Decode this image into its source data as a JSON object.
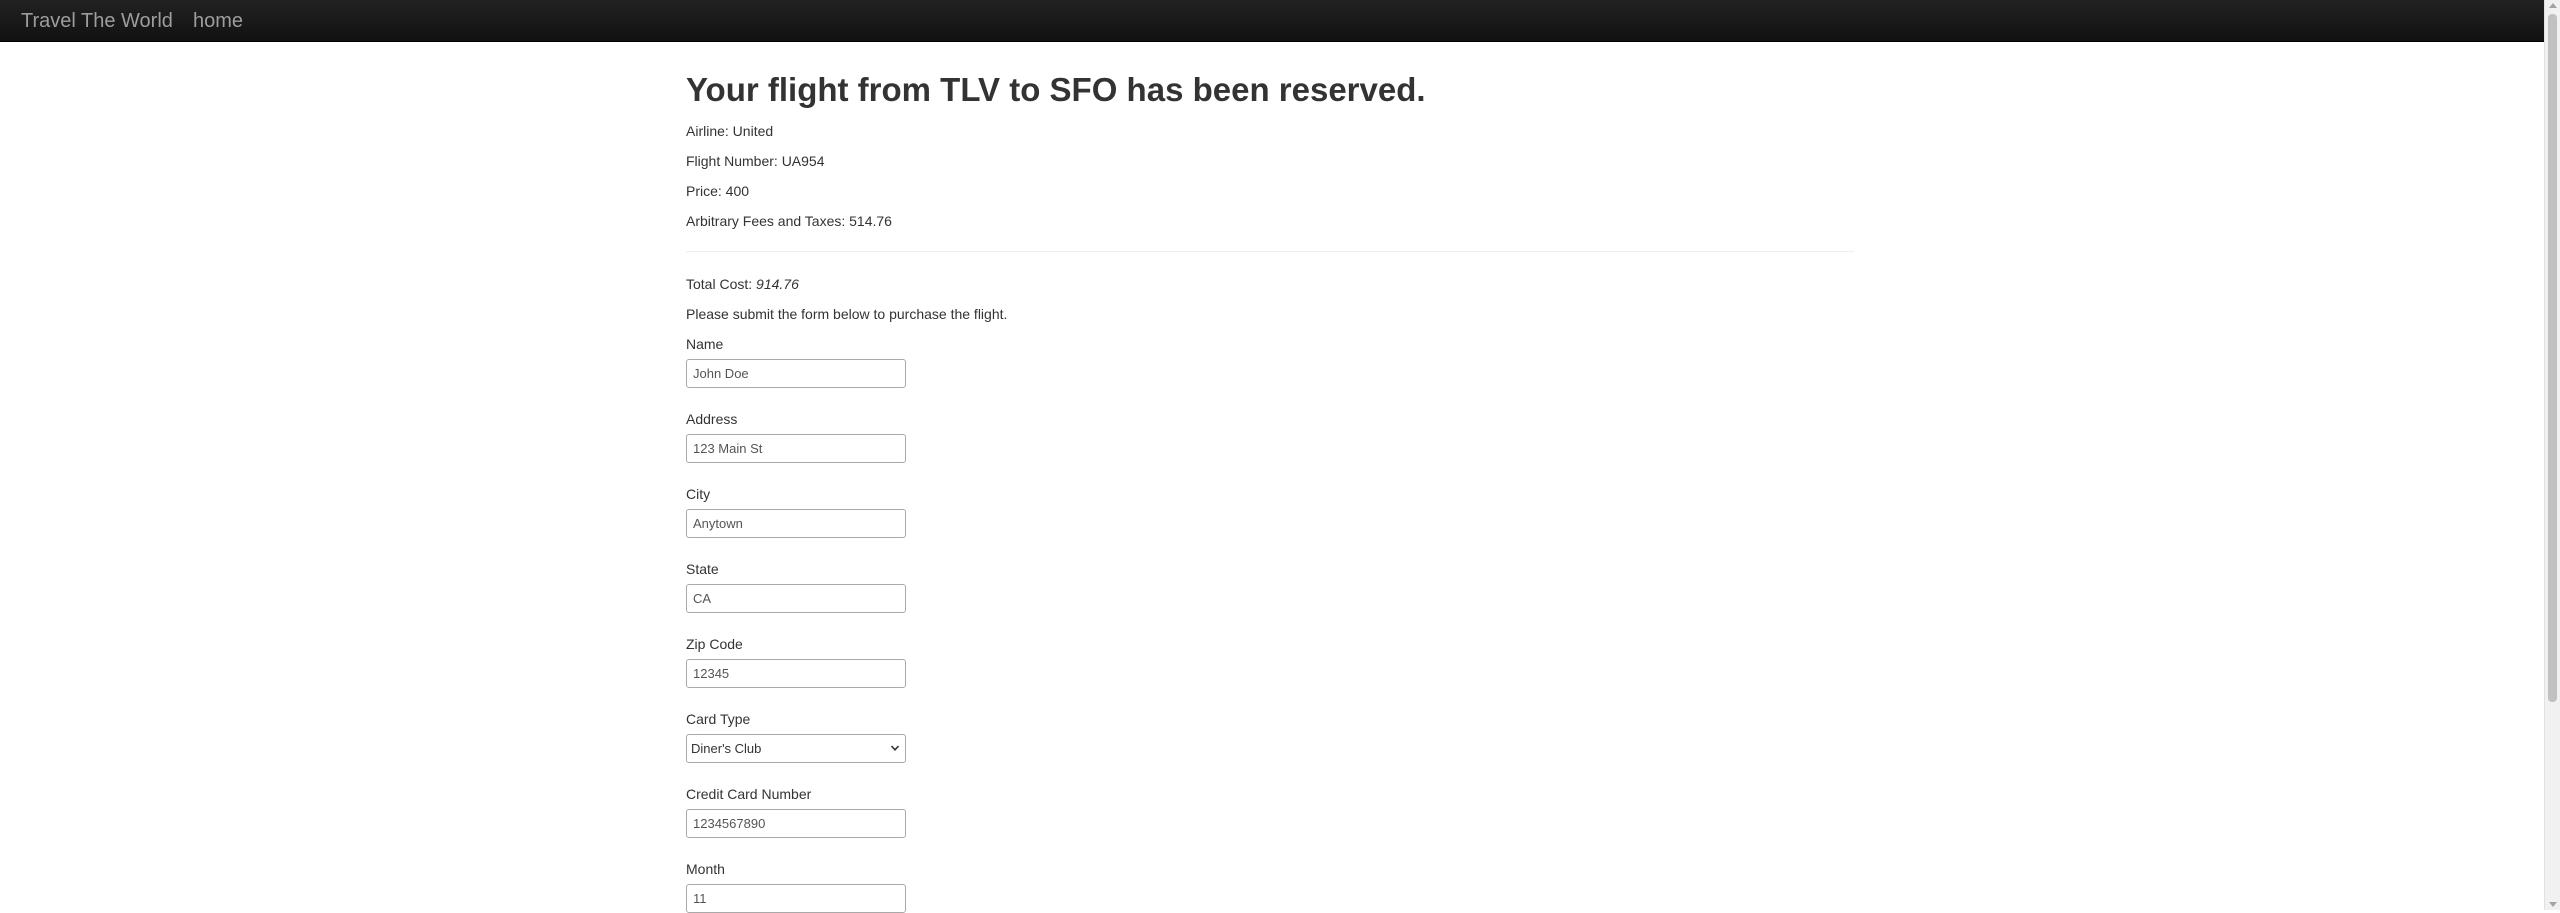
{
  "navbar": {
    "brand": "Travel The World",
    "home": "home"
  },
  "confirmation": {
    "heading": "Your flight from TLV to SFO has been reserved.",
    "airline": "Airline: United",
    "flight_number": "Flight Number: UA954",
    "price": "Price: 400",
    "fees": "Arbitrary Fees and Taxes: 514.76",
    "total_label": "Total Cost: ",
    "total_value": "914.76",
    "instructions": "Please submit the form below to purchase the flight."
  },
  "form": {
    "name_label": "Name",
    "name_value": "John Doe",
    "address_label": "Address",
    "address_value": "123 Main St",
    "city_label": "City",
    "city_value": "Anytown",
    "state_label": "State",
    "state_value": "CA",
    "zip_label": "Zip Code",
    "zip_value": "12345",
    "card_type_label": "Card Type",
    "card_type_value": "Diner's Club",
    "card_number_label": "Credit Card Number",
    "card_number_value": "1234567890",
    "month_label": "Month",
    "month_value": "11"
  },
  "icons": {
    "select_arrow": "chevron-down-icon"
  }
}
